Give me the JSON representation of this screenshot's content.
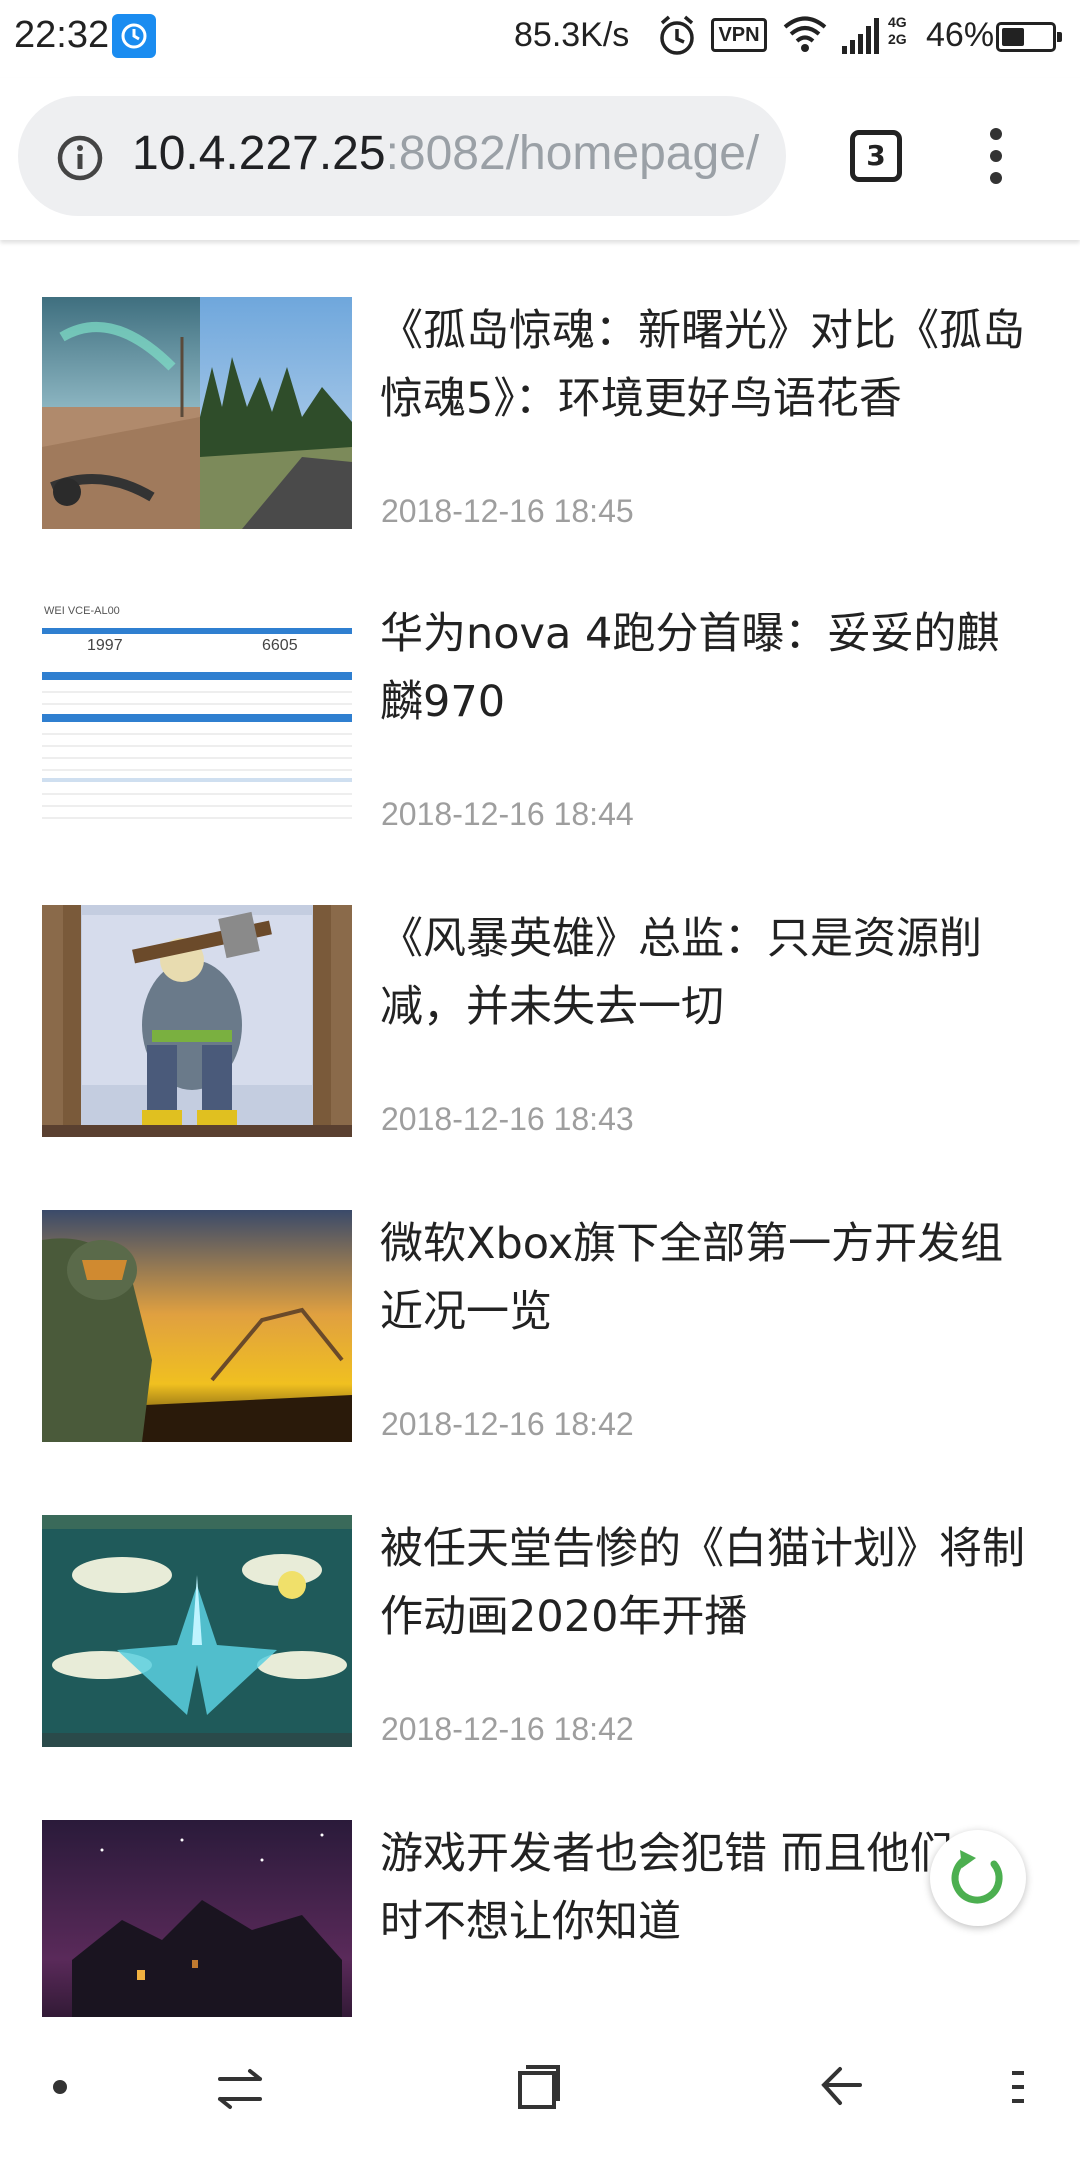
{
  "status_bar": {
    "time": "22:32",
    "speed": "85.3K/s",
    "vpn": "VPN",
    "network_top": "4G",
    "network_bottom": "2G",
    "battery": "46%",
    "battery_level": 0.46
  },
  "browser": {
    "url_host": "10.4.227.25",
    "url_rest": ":8082/homepage/",
    "tab_count": "3"
  },
  "articles": [
    {
      "title": "《孤岛惊魂：新曙光》对比《孤岛惊魂5》：环境更好鸟语花香",
      "date": "2018-12-16 18:45"
    },
    {
      "title": "华为nova 4跑分首曝：妥妥的麒麟970",
      "date": "2018-12-16 18:44"
    },
    {
      "title": "《风暴英雄》总监：只是资源削减，并未失去一切",
      "date": "2018-12-16 18:43"
    },
    {
      "title": "微软Xbox旗下全部第一方开发组近况一览",
      "date": "2018-12-16 18:42"
    },
    {
      "title": "被任天堂告惨的《白猫计划》将制作动画2020年开播",
      "date": "2018-12-16 18:42"
    },
    {
      "title": "游戏开发者也会犯错 而且他们有时不想让你知道",
      "date": ""
    }
  ],
  "thumb2_text": {
    "header": "WEI VCE-AL00",
    "score_single": "1997",
    "score_multi": "6605"
  },
  "colors": {
    "accent_refresh": "#4caf50",
    "date_gray": "#9e9e9e",
    "url_gray": "#9aa0a6"
  },
  "icons": {
    "nav": [
      "dot-icon",
      "switch-icon",
      "square-icon",
      "back-icon",
      "menu-icon"
    ]
  }
}
